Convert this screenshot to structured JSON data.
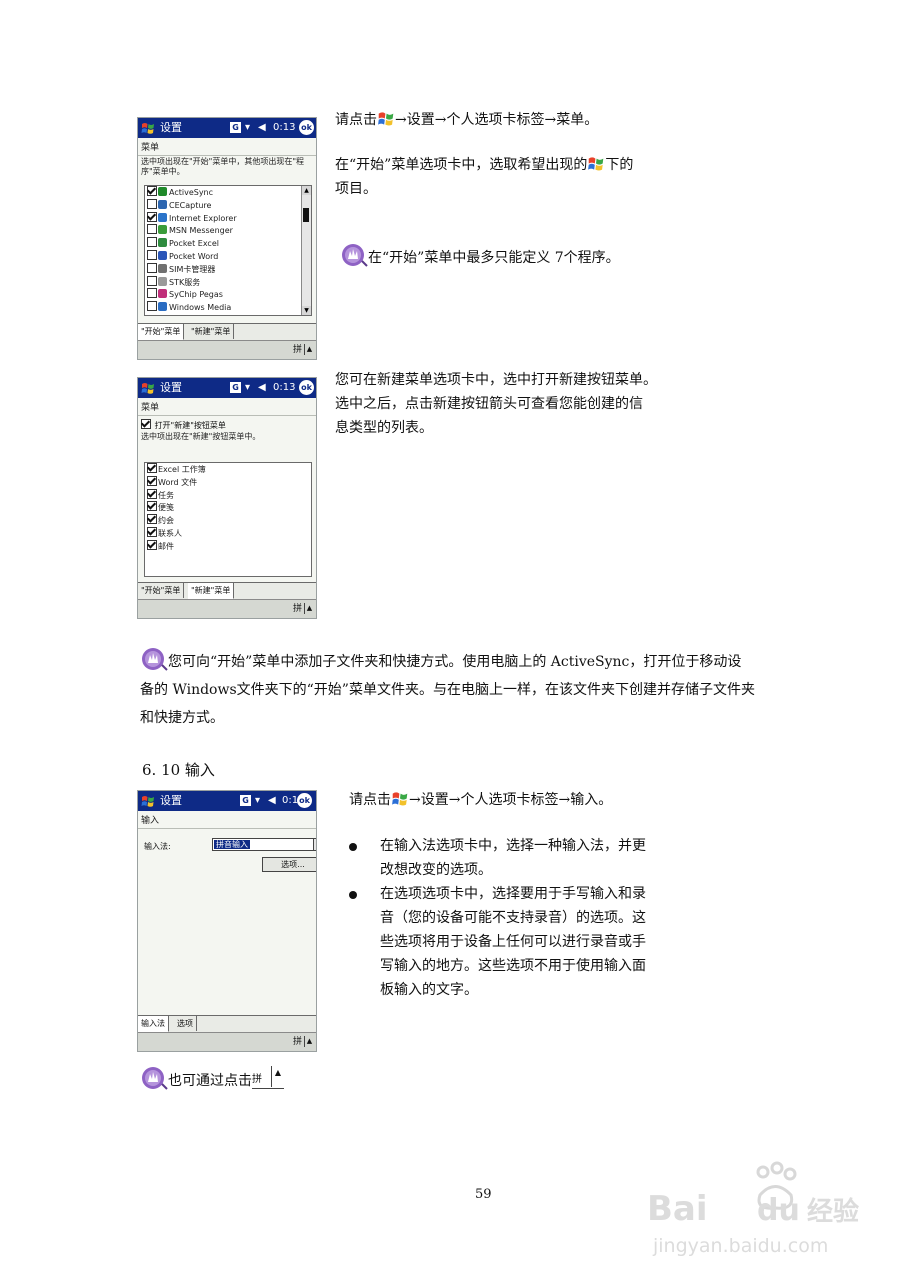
{
  "page": {
    "number": "59"
  },
  "section_heading": "6. 10 输入",
  "screen1": {
    "title": "设置",
    "time": "0:13",
    "ok": "ok",
    "signal_badge": "G",
    "subtitle": "菜单",
    "description": "选中项出现在\"开始\"菜单中，其他项出现在\"程序\"菜单中。",
    "items": [
      {
        "label": "ActiveSync",
        "checked": true,
        "icon_color": "#1f8a2a"
      },
      {
        "label": "CECapture",
        "checked": false,
        "icon_color": "#2d66b0"
      },
      {
        "label": "Internet Explorer",
        "checked": true,
        "icon_color": "#2a73c9"
      },
      {
        "label": "MSN Messenger",
        "checked": false,
        "icon_color": "#3a9c3a"
      },
      {
        "label": "Pocket Excel",
        "checked": false,
        "icon_color": "#2e8b3e"
      },
      {
        "label": "Pocket Word",
        "checked": false,
        "icon_color": "#2a55b8"
      },
      {
        "label": "SIM卡管理器",
        "checked": false,
        "icon_color": "#707070"
      },
      {
        "label": "STK服务",
        "checked": false,
        "icon_color": "#9a9a9a"
      },
      {
        "label": "SyChip Pegas",
        "checked": false,
        "icon_color": "#c02e7a"
      },
      {
        "label": "Windows Media",
        "checked": false,
        "icon_color": "#2a6cc2"
      }
    ],
    "tabs": [
      "\"开始\"菜单",
      "\"新建\"菜单"
    ],
    "ime": "拼"
  },
  "screen2": {
    "title": "设置",
    "time": "0:13",
    "ok": "ok",
    "signal_badge": "G",
    "subtitle": "菜单",
    "toggle_label": "打开\"新建\"按钮菜单",
    "description": "选中项出现在\"新建\"按钮菜单中。",
    "items": [
      {
        "label": "Excel 工作簿",
        "checked": true
      },
      {
        "label": "Word 文件",
        "checked": true
      },
      {
        "label": "任务",
        "checked": true
      },
      {
        "label": "便笺",
        "checked": true
      },
      {
        "label": "约会",
        "checked": true
      },
      {
        "label": "联系人",
        "checked": true
      },
      {
        "label": "邮件",
        "checked": true
      }
    ],
    "tabs": [
      "\"开始\"菜单",
      "\"新建\"菜单"
    ],
    "ime": "拼"
  },
  "screen3": {
    "title": "设置",
    "time": "0:14",
    "ok": "ok",
    "signal_badge": "G",
    "subtitle": "输入",
    "field_label": "输入法:",
    "field_value": "拼音输入",
    "options_button": "选项...",
    "tabs": [
      "输入法",
      "选项"
    ],
    "ime": "拼"
  },
  "text": {
    "s1_line1_a": "请点击",
    "s1_line1_b": "→设置→个人选项卡标签→菜单。",
    "s1_line2_a": "在“开始”菜单选项卡中，选取希望出现的",
    "s1_line2_b": "下的",
    "s1_line3": "项目。",
    "s1_note": "在“开始”菜单中最多只能定义 7个程序。",
    "s2_line1": "您可在新建菜单选项卡中，选中打开新建按钮菜单。",
    "s2_line2": "选中之后，点击新建按钮箭头可查看您能创建的信",
    "s2_line3": "息类型的列表。",
    "note_wide_line1": "您可向“开始”菜单中添加子文件夹和快捷方式。使用电脑上的  ActiveSync，打开位于移动设",
    "note_wide_line2": "备的 Windows文件夹下的“开始”菜单文件夹。与在电脑上一样，在该文件夹下创建并存储子文件夹",
    "note_wide_line3": "和快捷方式。",
    "s3_line1_a": "请点击",
    "s3_line1_b": "→设置→个人选项卡标签→输入。",
    "bullet1_line1": "在输入法选项卡中，选择一种输入法，并更",
    "bullet1_line2": "改想改变的选项。",
    "bullet2_line1": "在选项选项卡中，选择要用于手写输入和录",
    "bullet2_line2": "音（您的设备可能不支持录音）的选项。这",
    "bullet2_line3": "些选项将用于设备上任何可以进行录音或手",
    "bullet2_line4": "写输入的地方。这些选项不用于使用输入面",
    "bullet2_line5": "板输入的文字。",
    "final_note": "也可通过点击",
    "final_ime_a": "拼",
    "final_ime_b": "▲"
  },
  "colors": {
    "titlebar": "#0e2a86",
    "note_icon": "#7a4fb2"
  }
}
